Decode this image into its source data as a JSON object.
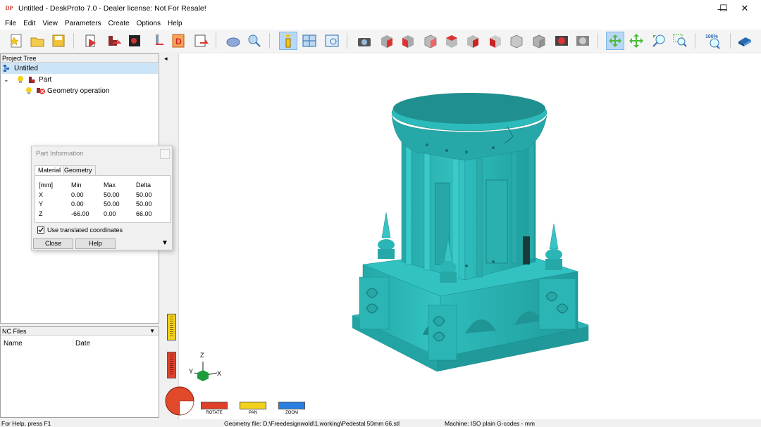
{
  "window": {
    "title": "Untitled - DeskProto 7.0 - Dealer license: Not For Resale!",
    "app_icon_text": "DP",
    "controls": {
      "minimize": "—",
      "maximize": "☐",
      "close": "✕"
    }
  },
  "menu": [
    "File",
    "Edit",
    "View",
    "Parameters",
    "Create",
    "Options",
    "Help"
  ],
  "toolbar": {
    "zoom_percent": "100%"
  },
  "project_tree": {
    "header": "Project Tree",
    "items": [
      {
        "label": "Untitled"
      },
      {
        "label": "Part",
        "expander": "⌄"
      },
      {
        "label": "Geometry operation"
      }
    ]
  },
  "nc_files": {
    "header": "NC Files",
    "dropdown_arrow": "▼",
    "columns": [
      "Name",
      "Date"
    ]
  },
  "part_information": {
    "title": "Part Information",
    "tabs": [
      "Material",
      "Geometry"
    ],
    "columns": [
      "[mm]",
      "Min",
      "Max",
      "Delta"
    ],
    "rows": [
      {
        "axis": "X",
        "min": "0.00",
        "max": "50.00",
        "delta": "50.00"
      },
      {
        "axis": "Y",
        "min": "0.00",
        "max": "50.00",
        "delta": "50.00"
      },
      {
        "axis": "Z",
        "min": "-66.00",
        "max": "0.00",
        "delta": "66.00"
      }
    ],
    "checkbox_label": "Use translated coordinates",
    "checkbox_checked": true,
    "close_label": "Close",
    "help_label": "Help",
    "expand_arrow": "▼"
  },
  "viewport": {
    "collapse_arrow": "◂",
    "axis_labels": {
      "z": "Z",
      "y": "Y",
      "x": "X"
    },
    "model_color": "#2ab3b3"
  },
  "mouse_modes": [
    {
      "label": "ROTATE",
      "color": "#e0402a"
    },
    {
      "label": "PAN",
      "color": "#f2d21a"
    },
    {
      "label": "ZOOM",
      "color": "#2a7ee0"
    }
  ],
  "statusbar": {
    "help": "For Help, press F1",
    "geometry_file": "Geometry file: D:\\Freedesignwold\\1.working\\Pedestal 50mm 66.stl",
    "machine": "Machine: ISO plain G-codes - mm"
  }
}
